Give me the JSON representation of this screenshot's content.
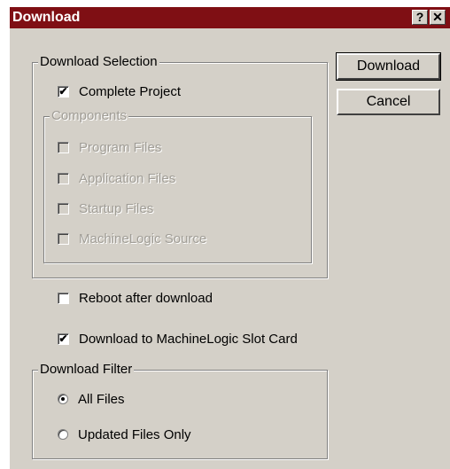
{
  "window": {
    "title": "Download",
    "help_glyph": "?",
    "close_glyph": "✕",
    "title_color": "#7f0f14",
    "face_color": "#d4d0c8"
  },
  "buttons": {
    "download": "Download",
    "cancel": "Cancel"
  },
  "download_selection": {
    "legend": "Download Selection",
    "complete_project": {
      "label": "Complete Project",
      "checked": true
    },
    "components": {
      "legend": "Components",
      "items": [
        {
          "label": "Program Files",
          "checked": false,
          "enabled": false
        },
        {
          "label": "Application Files",
          "checked": false,
          "enabled": false
        },
        {
          "label": "Startup Files",
          "checked": false,
          "enabled": false
        },
        {
          "label": "MachineLogic Source",
          "checked": false,
          "enabled": false
        }
      ]
    }
  },
  "options": {
    "reboot": {
      "label": "Reboot after download",
      "checked": false
    },
    "slot_card": {
      "label": "Download to MachineLogic Slot Card",
      "checked": true
    }
  },
  "download_filter": {
    "legend": "Download Filter",
    "selected": "All Files",
    "options": [
      "All Files",
      "Updated Files Only"
    ]
  },
  "check_glyph": "✔"
}
